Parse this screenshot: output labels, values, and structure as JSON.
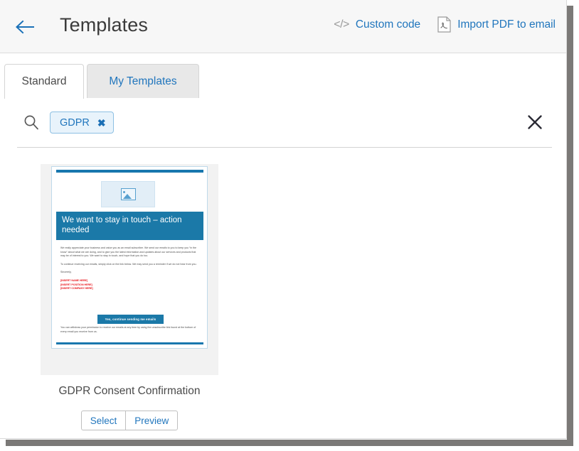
{
  "header": {
    "back_icon": "arrow-left-icon",
    "title": "Templates",
    "actions": [
      {
        "icon": "code-icon",
        "glyph": "</>",
        "label": "Custom code"
      },
      {
        "icon": "pdf-file-icon",
        "label": "Import PDF to email"
      }
    ]
  },
  "tabs": [
    {
      "label": "Standard",
      "active": true
    },
    {
      "label": "My Templates",
      "active": false
    }
  ],
  "search": {
    "icon": "search-icon",
    "chip": {
      "label": "GDPR",
      "remove_glyph": "✖"
    },
    "clear_icon": "close-icon"
  },
  "templates": [
    {
      "title": "GDPR Consent Confirmation",
      "select_label": "Select",
      "preview_label": "Preview",
      "preview": {
        "image_placeholder_icon": "image-placeholder-icon",
        "headline": "We want to stay in touch – action needed",
        "paragraphs": [
          "We really appreciate your business and value you as an email subscriber. We send our emails to you to keep you “in the know” about what we are doing, and to give you the latest information and updates about our services and products that may be of interest to you. We want to stay in touch, and hope that you do too.",
          "To continue receiving our emails, simply click on the link below. We may send you a reminder if we do not hear from you.",
          "Sincerely,"
        ],
        "placeholders": [
          "[INSERT NAME HERE]",
          "[INSERT POSITION HERE]",
          "[INSERT COMPANY HERE]"
        ],
        "cta_label": "Yes, continue sending me emails",
        "footer": "You can withdraw your permission to receive our emails at any time by using the unsubscribe link found at the bottom of every email you receive from us."
      }
    }
  ],
  "colors": {
    "accent_blue": "#2176bd",
    "email_header_blue": "#1b79a8",
    "email_bar_blue": "#1877ae",
    "placeholder_red": "#e8131a",
    "chip_bg": "#e8f3fb",
    "chip_border": "#8dc0e3"
  }
}
